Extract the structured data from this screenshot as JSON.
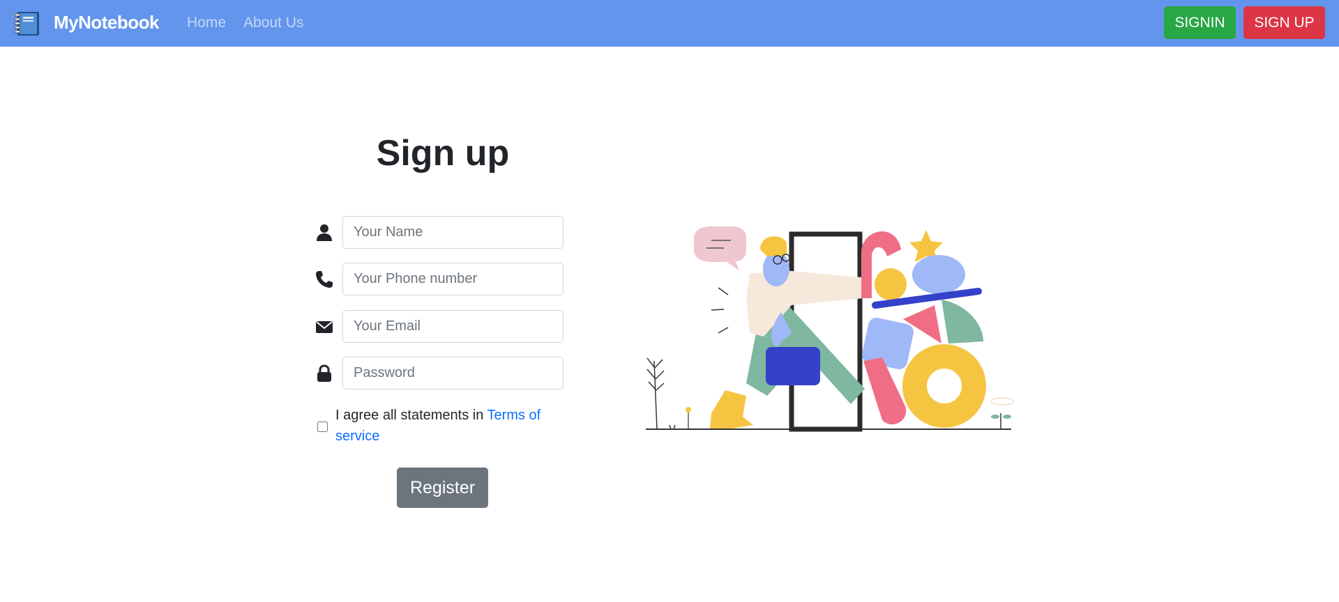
{
  "navbar": {
    "brand": "MyNotebook",
    "brand_icon": "notebook-icon",
    "links": [
      "Home",
      "About Us"
    ],
    "signin_label": "SIGNIN",
    "signup_label": "SIGN UP",
    "colors": {
      "navbar_bg": "#6495ed",
      "signin_bg": "#28a745",
      "signup_bg": "#dc3545"
    }
  },
  "form": {
    "title": "Sign up",
    "fields": [
      {
        "icon": "user-icon",
        "placeholder": "Your Name",
        "value": ""
      },
      {
        "icon": "phone-icon",
        "placeholder": "Your Phone number",
        "value": ""
      },
      {
        "icon": "envelope-icon",
        "placeholder": "Your Email",
        "value": ""
      },
      {
        "icon": "lock-icon",
        "placeholder": "Password",
        "value": ""
      }
    ],
    "terms_text": "I agree all statements in",
    "terms_link": "Terms of service",
    "terms_checked": false,
    "register_label": "Register"
  },
  "illustration": {
    "icon": "signup-illustration"
  }
}
